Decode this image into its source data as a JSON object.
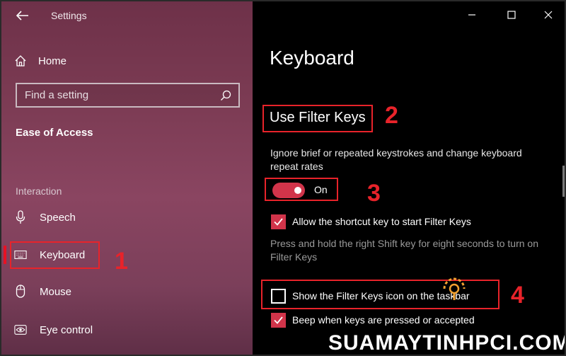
{
  "window": {
    "title": "Settings",
    "controls": {
      "minimize": "minimize",
      "maximize": "maximize",
      "close": "close"
    }
  },
  "sidebar": {
    "home_label": "Home",
    "search_placeholder": "Find a setting",
    "section_title": "Ease of Access",
    "group_label": "Interaction",
    "items": [
      {
        "label": "Speech",
        "icon": "microphone-icon"
      },
      {
        "label": "Keyboard",
        "icon": "keyboard-icon",
        "selected": true
      },
      {
        "label": "Mouse",
        "icon": "mouse-icon"
      },
      {
        "label": "Eye control",
        "icon": "eye-icon"
      }
    ]
  },
  "main": {
    "page_title": "Keyboard",
    "filter_heading": "Use Filter Keys",
    "description": "Ignore brief or repeated keystrokes and change keyboard repeat rates",
    "toggle": {
      "state": "On",
      "checked": true
    },
    "shortcut_option": {
      "label": "Allow the shortcut key to start Filter Keys",
      "checked": true
    },
    "shortcut_note": "Press and hold the right Shift key for eight seconds to turn on Filter Keys",
    "taskbar_icon_option": {
      "label": "Show the Filter Keys icon on the taskbar",
      "checked": false
    },
    "beep_option": {
      "label": "Beep when keys are pressed or accepted",
      "checked": true
    }
  },
  "annotations": [
    "1",
    "2",
    "3",
    "4"
  ],
  "watermark": "SUAMAYTINHPCI.COM",
  "colors": {
    "accent": "#d1344a",
    "annotation": "#e8232a",
    "sidebar": "#7a3a52",
    "content_bg": "#000000"
  }
}
